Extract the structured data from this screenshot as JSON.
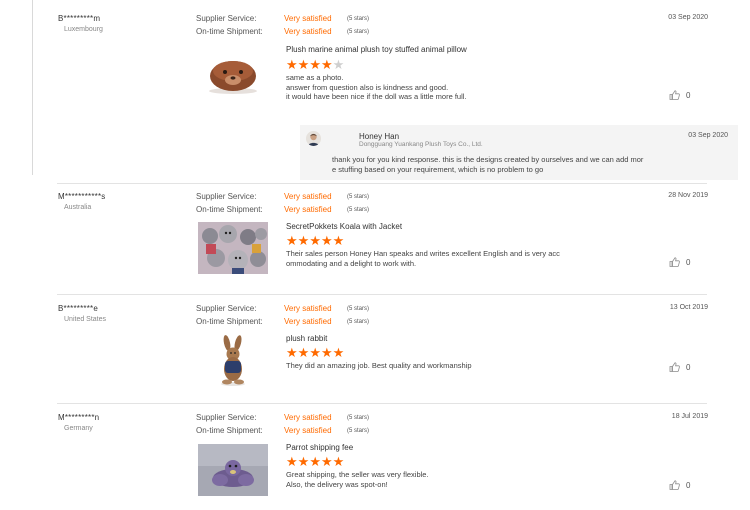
{
  "labels": {
    "supplier_service": "Supplier Service:",
    "on_time_shipment": "On-time Shipment:"
  },
  "colors": {
    "accent": "#ff6a00",
    "star_empty": "#cfcfcf"
  },
  "reviews": [
    {
      "buyer": "B*********m",
      "country": "Luxembourg",
      "date": "03 Sep 2020",
      "supplier_rating_text": "Very satisfied",
      "supplier_rating_stars": "(5 stars)",
      "shipment_rating_text": "Very satisfied",
      "shipment_rating_stars": "(5 stars)",
      "product_title": "Plush marine animal plush toy stuffed animal pillow",
      "rating": 4,
      "comment_lines": [
        "same as a photo.",
        "answer from question also is kindness and good.",
        "it would have been nice if the doll was a little more full."
      ],
      "likes": "0",
      "thumb_icon": "seal-plush-photo",
      "reply": {
        "name": "Honey Han",
        "company": "Dongguang Yuankang Plush Toys Co., Ltd.",
        "date": "03 Sep 2020",
        "text_lines": [
          "thank you for you kind response.  this is the designs created by ourselves and we can add mor",
          "e stuffing based on your requirement, which is no problem to go"
        ]
      }
    },
    {
      "buyer": "M***********s",
      "country": "Australia",
      "date": "28 Nov 2019",
      "supplier_rating_text": "Very satisfied",
      "supplier_rating_stars": "(5 stars)",
      "shipment_rating_text": "Very satisfied",
      "shipment_rating_stars": "(5 stars)",
      "product_title": "SecretPokkets Koala with Jacket",
      "rating": 5,
      "comment_lines": [
        "Their sales person Honey Han speaks and writes excellent English and is very acc",
        "ommodating and a delight to work with."
      ],
      "likes": "0",
      "thumb_icon": "koala-plush-photo"
    },
    {
      "buyer": "B*********e",
      "country": "United States",
      "date": "13 Oct 2019",
      "supplier_rating_text": "Very satisfied",
      "supplier_rating_stars": "(5 stars)",
      "shipment_rating_text": "Very satisfied",
      "shipment_rating_stars": "(5 stars)",
      "product_title": "plush rabbit",
      "rating": 5,
      "comment_lines": [
        "They did an amazing job. Best quality and workmanship"
      ],
      "likes": "0",
      "thumb_icon": "rabbit-plush-photo"
    },
    {
      "buyer": "M*********n",
      "country": "Germany",
      "date": "18 Jul 2019",
      "supplier_rating_text": "Very satisfied",
      "supplier_rating_stars": "(5 stars)",
      "shipment_rating_text": "Very satisfied",
      "shipment_rating_stars": "(5 stars)",
      "product_title": "Parrot shipping fee",
      "rating": 5,
      "comment_lines": [
        "Great shipping, the seller was very flexible.",
        "Also, the delivery was spot-on!"
      ],
      "likes": "0",
      "thumb_icon": "parrot-plush-photo"
    }
  ]
}
